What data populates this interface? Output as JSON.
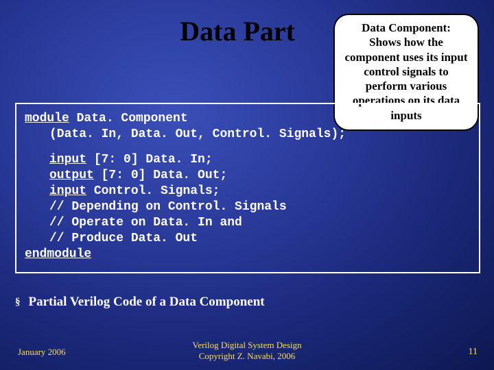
{
  "title": "Data Part",
  "callout": {
    "heading": "Data Component:",
    "body": "Shows how the component uses its input control signals to perform various operations on its data inputs"
  },
  "code": {
    "kw_module": "module",
    "mod_name": " Data. Component",
    "ports": "(Data. In, Data. Out, Control. Signals);",
    "kw_input1": "input",
    "line_input1": "  [7: 0] Data. In;",
    "kw_output": "output",
    "line_output": " [7: 0] Data. Out;",
    "kw_input2": "input",
    "line_input2": "  Control. Signals;",
    "comment1": "// Depending on Control. Signals",
    "comment2": "// Operate on Data. In and",
    "comment3": "// Produce Data. Out",
    "kw_endmodule": "endmodule"
  },
  "caption": "Partial Verilog Code of a Data Component",
  "footer": {
    "date": "January 2006",
    "credit_line1": "Verilog Digital System Design",
    "credit_line2": "Copyright Z. Navabi, 2006",
    "page": "11"
  }
}
